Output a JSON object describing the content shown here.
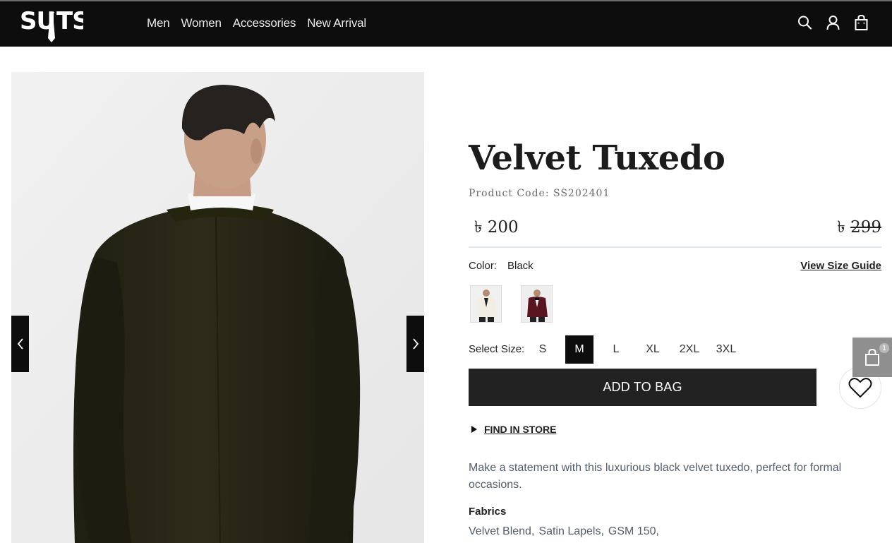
{
  "header": {
    "logo_text": "SUITS",
    "nav": [
      "Men",
      "Women",
      "Accessories",
      "New Arrival"
    ],
    "icons": [
      "search-icon",
      "user-icon",
      "shopping-bag-icon"
    ]
  },
  "gallery": {
    "prev_icon": "chevron-left-icon",
    "next_icon": "chevron-right-icon"
  },
  "product": {
    "title": "Velvet Tuxedo",
    "code": "Product Code: SS202401",
    "currency": "৳",
    "price": "200",
    "old_price": "299",
    "color_label": "Color:",
    "color_value": "Black",
    "size_guide": "View Size Guide",
    "size_label": "Select Size:",
    "sizes": [
      "S",
      "M",
      "L",
      "XL",
      "2XL",
      "3XL"
    ],
    "selected_size": "M",
    "add_to_bag": "ADD TO BAG",
    "find_in_store": "FIND IN STORE",
    "description": "Make a statement with this luxurious black velvet tuxedo, perfect for formal occasions.",
    "fabrics_heading": "Fabrics",
    "fabrics": [
      "Velvet Blend,",
      "Satin Lapels,",
      "GSM 150,"
    ]
  },
  "cart": {
    "count": "1"
  },
  "colors": {
    "header_bg": "#0d0d0d",
    "button_bg": "#222222",
    "jacket": "#2b2a18"
  }
}
